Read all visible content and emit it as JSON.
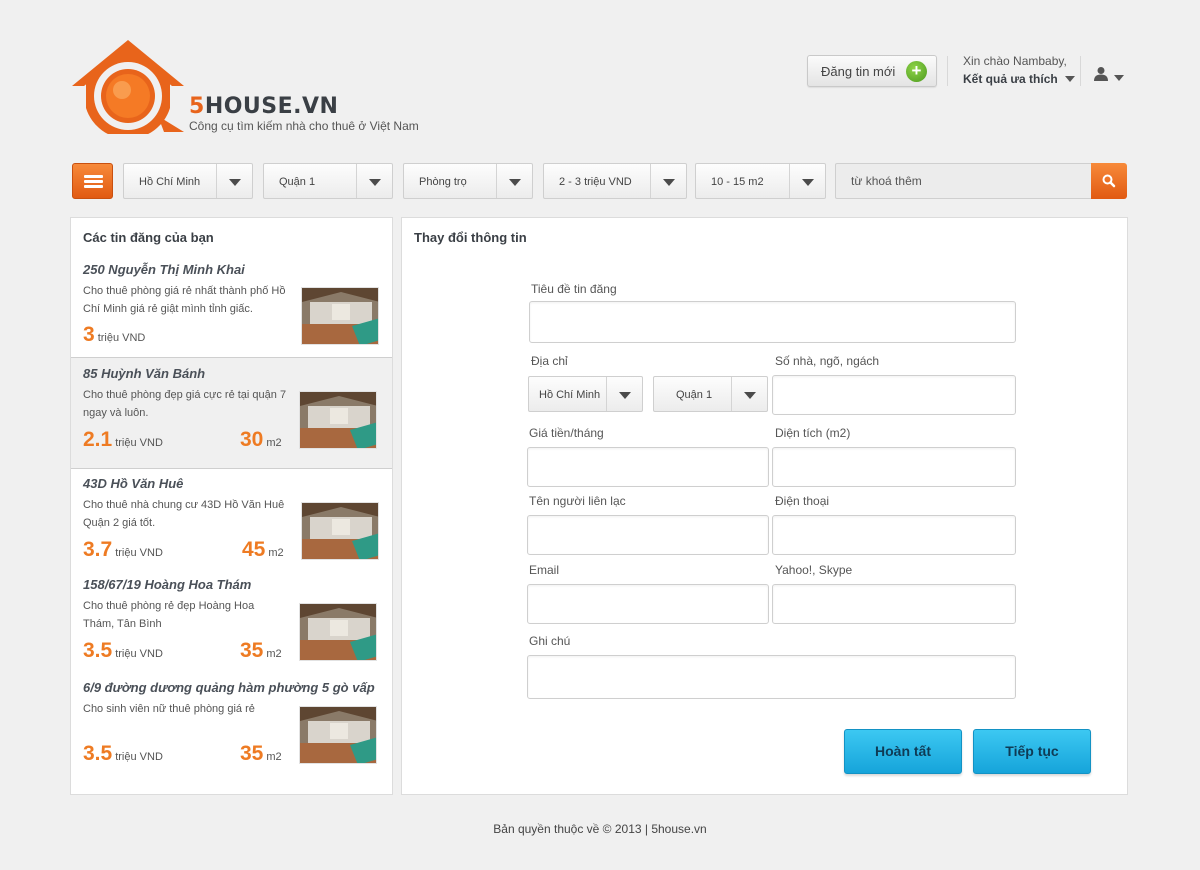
{
  "header": {
    "logo_text_accent": "5",
    "logo_text_rest": "HOUSE.VN",
    "tagline": "Công cụ tìm kiếm nhà cho thuê ở Việt Nam",
    "post_button_label": "Đăng tin mới",
    "greeting": "Xin chào Nambaby,",
    "favorites_label": "Kết quả ưa thích",
    "brand_color": "#e8641b"
  },
  "search": {
    "city": "Hồ Chí Minh",
    "district": "Quận 1",
    "type": "Phòng trọ",
    "price_range": "2 - 3 triệu VND",
    "area_range": "10 - 15 m2",
    "keyword_placeholder": "từ khoá thêm"
  },
  "sidebar": {
    "title": "Các tin đăng của bạn",
    "listings": [
      {
        "title": "250 Nguyễn Thị Minh Khai",
        "desc": "Cho thuê phòng giá rẻ nhất thành phố Hồ Chí Minh giá rẻ giật mình tỉnh giấc.",
        "price": "3",
        "price_unit": "triệu VND",
        "area": "",
        "area_unit": ""
      },
      {
        "title": "85 Huỳnh Văn Bánh",
        "desc": "Cho thuê phòng đẹp giá cực rẻ tại quận 7 ngay và luôn.",
        "price": "2.1",
        "price_unit": "triệu VND",
        "area": "30",
        "area_unit": "m2"
      },
      {
        "title": "43D Hồ Văn Huê",
        "desc": "Cho thuê nhà chung cư 43D Hồ Văn Huê Quận 2 giá tốt.",
        "price": "3.7",
        "price_unit": "triệu VND",
        "area": "45",
        "area_unit": "m2"
      },
      {
        "title": "158/67/19 Hoàng Hoa Thám",
        "desc": "Cho thuê phòng rẻ đẹp Hoàng Hoa Thám, Tân Bình",
        "price": "3.5",
        "price_unit": "triệu VND",
        "area": "35",
        "area_unit": "m2"
      },
      {
        "title": "6/9 đường dương quảng hàm phường 5 gò vấp",
        "desc": "Cho sinh viên nữ thuê phòng giá rẻ",
        "price": "3.5",
        "price_unit": "triệu VND",
        "area": "35",
        "area_unit": "m2"
      }
    ]
  },
  "form": {
    "title": "Thay đổi thông tin",
    "labels": {
      "post_title": "Tiêu đề tin đăng",
      "address": "Địa chỉ",
      "house_number": "Số nhà, ngõ, ngách",
      "price": "Giá tiền/tháng",
      "area": "Diện tích (m2)",
      "contact_name": "Tên người liên lạc",
      "phone": "Điện thoại",
      "email": "Email",
      "im": "Yahoo!, Skype",
      "note": "Ghi chú"
    },
    "address_city": "Hồ Chí Minh",
    "address_district": "Quận 1",
    "finish_button": "Hoàn tất",
    "continue_button": "Tiếp tục"
  },
  "footer": {
    "copyright": "Bản quyền thuộc về © 2013 | 5house.vn"
  }
}
